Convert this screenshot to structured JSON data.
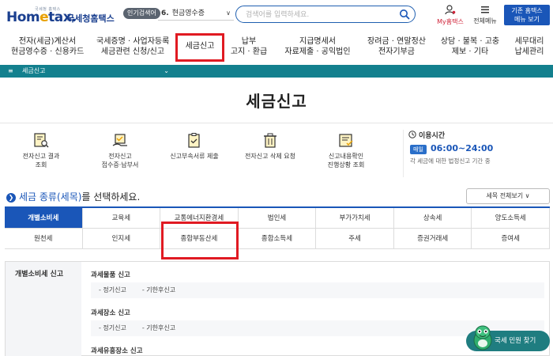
{
  "header": {
    "logo_small": "국세청 홈택스",
    "logo_text_a": "Hom",
    "logo_text_e": "e",
    "logo_text_b": "tax.",
    "logo_korean": "국세청홈택스",
    "popular_badge": "인기검색어",
    "popular_number": "6.",
    "popular_value": "현금영수증",
    "search_placeholder": "검색어를 입력하세요.",
    "my_home_label": "My홈택스",
    "all_menu_label": "전체메뉴",
    "old_home_line1": "기존 홈택스",
    "old_home_line2": "메뉴 보기"
  },
  "mainnav": {
    "items": [
      {
        "line1": "전자(세금)계산서",
        "line2": "현금영수증 · 신용카드"
      },
      {
        "line1": "국세증명 · 사업자등록",
        "line2": "세금관련 신청/신고"
      },
      {
        "line1": "세금신고",
        "line2": ""
      },
      {
        "line1": "납부",
        "line2": "고지 · 환급"
      },
      {
        "line1": "지급명세서",
        "line2": "자료제출 · 공익법인"
      },
      {
        "line1": "장려금 · 연말정산",
        "line2": "전자기부금"
      },
      {
        "line1": "상담 · 불복 · 고충",
        "line2": "제보 · 기타"
      },
      {
        "line1": "세무대리",
        "line2": "납세관리"
      }
    ]
  },
  "breadcrumb": {
    "label": "세금신고"
  },
  "page_title": "세금신고",
  "services": [
    {
      "line1": "전자신고 결과",
      "line2": "조회"
    },
    {
      "line1": "전자신고",
      "line2": "접수증·납부서"
    },
    {
      "line1": "신고부속서류 제출",
      "line2": ""
    },
    {
      "line1": "전자신고 삭제 요청",
      "line2": ""
    },
    {
      "line1": "신고내용확인",
      "line2": "진행상황 조회"
    }
  ],
  "usage_time": {
    "title": "이용시간",
    "badge": "매일",
    "value": "06:00~24:00",
    "desc": "각 세금에 대한 법정신고 기간 중"
  },
  "tax_section": {
    "heading_accent": "세금 종류(세목)",
    "heading_rest": "를 선택하세요.",
    "view_all": "세목 전체보기 ∨",
    "row1": [
      "개별소비세",
      "교육세",
      "교통에너지환경세",
      "법인세",
      "부가가치세",
      "상속세",
      "양도소득세"
    ],
    "row2": [
      "원천세",
      "인지세",
      "종합부동산세",
      "종합소득세",
      "주세",
      "증권거래세",
      "증여세"
    ]
  },
  "content": {
    "side_label": "개별소비세 신고",
    "groups": [
      {
        "title": "과세물품 신고",
        "item1": "- 정기신고",
        "item2": "- 기한후신고"
      },
      {
        "title": "과세장소 신고",
        "item1": "- 정기신고",
        "item2": "- 기한후신고"
      },
      {
        "title": "과세유흥장소 신고"
      }
    ]
  },
  "chat": {
    "label": "국세 민원 찾기"
  },
  "colors": {
    "brand_blue": "#1a56b8",
    "teal": "#13808e",
    "highlight_red": "#e01a22"
  }
}
